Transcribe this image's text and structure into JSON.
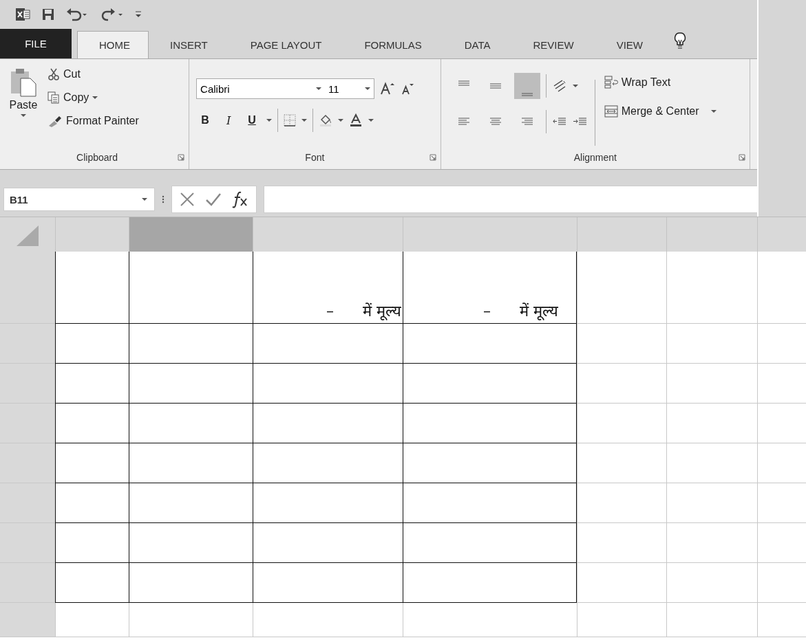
{
  "tabs": [
    {
      "label": "FILE",
      "kind": "file",
      "selected": false
    },
    {
      "label": "HOME",
      "kind": "tab",
      "selected": true
    },
    {
      "label": "INSERT",
      "kind": "tab",
      "selected": false
    },
    {
      "label": "PAGE LAYOUT",
      "kind": "tab",
      "selected": false
    },
    {
      "label": "FORMULAS",
      "kind": "tab",
      "selected": false
    },
    {
      "label": "DATA",
      "kind": "tab",
      "selected": false
    },
    {
      "label": "REVIEW",
      "kind": "tab",
      "selected": false
    },
    {
      "label": "VIEW",
      "kind": "tab",
      "selected": false
    }
  ],
  "clipboard": {
    "paste": "Paste",
    "cut": "Cut",
    "copy": "Copy",
    "format_painter": "Format Painter",
    "label": "Clipboard"
  },
  "font": {
    "name": "Calibri",
    "size": "11",
    "bold": "B",
    "italic": "I",
    "underline": "U",
    "label": "Font"
  },
  "alignment": {
    "bottom_align_selected": true,
    "wrap_text": "Wrap Text",
    "merge_center": "Merge & Center",
    "label": "Alignment"
  },
  "name_box": "B11",
  "grid": {
    "columns": [
      {
        "selected": false
      },
      {
        "selected": true
      },
      {
        "selected": false
      },
      {
        "selected": false
      },
      {
        "selected": false
      },
      {
        "selected": false
      },
      {
        "selected": false
      }
    ],
    "rows": [
      {
        "cells": [
          {
            "bordered": true
          },
          {
            "bordered": true
          },
          {
            "bordered": true,
            "text": "–      में मूल्य"
          },
          {
            "bordered": true,
            "text": "–      में मूल्य"
          },
          {
            "bordered": false
          },
          {
            "bordered": false
          },
          {
            "bordered": false
          }
        ]
      },
      {
        "cells": [
          {
            "bordered": true
          },
          {
            "bordered": true
          },
          {
            "bordered": true
          },
          {
            "bordered": true
          },
          {
            "bordered": false
          },
          {
            "bordered": false
          },
          {
            "bordered": false
          }
        ]
      },
      {
        "cells": [
          {
            "bordered": true
          },
          {
            "bordered": true
          },
          {
            "bordered": true
          },
          {
            "bordered": true
          },
          {
            "bordered": false
          },
          {
            "bordered": false
          },
          {
            "bordered": false
          }
        ]
      },
      {
        "cells": [
          {
            "bordered": true
          },
          {
            "bordered": true
          },
          {
            "bordered": true
          },
          {
            "bordered": true
          },
          {
            "bordered": false
          },
          {
            "bordered": false
          },
          {
            "bordered": false
          }
        ]
      },
      {
        "cells": [
          {
            "bordered": true
          },
          {
            "bordered": true
          },
          {
            "bordered": true
          },
          {
            "bordered": true
          },
          {
            "bordered": false
          },
          {
            "bordered": false
          },
          {
            "bordered": false
          }
        ]
      },
      {
        "cells": [
          {
            "bordered": true
          },
          {
            "bordered": true
          },
          {
            "bordered": true
          },
          {
            "bordered": true
          },
          {
            "bordered": false
          },
          {
            "bordered": false
          },
          {
            "bordered": false
          }
        ]
      },
      {
        "cells": [
          {
            "bordered": true
          },
          {
            "bordered": true
          },
          {
            "bordered": true
          },
          {
            "bordered": true
          },
          {
            "bordered": false
          },
          {
            "bordered": false
          },
          {
            "bordered": false
          }
        ]
      },
      {
        "cells": [
          {
            "bordered": true
          },
          {
            "bordered": true
          },
          {
            "bordered": true
          },
          {
            "bordered": true
          },
          {
            "bordered": false
          },
          {
            "bordered": false
          },
          {
            "bordered": false
          }
        ]
      },
      {
        "cells": [
          {
            "bordered": false
          },
          {
            "bordered": false
          },
          {
            "bordered": false
          },
          {
            "bordered": false
          },
          {
            "bordered": false
          },
          {
            "bordered": false
          },
          {
            "bordered": false
          }
        ]
      }
    ]
  }
}
